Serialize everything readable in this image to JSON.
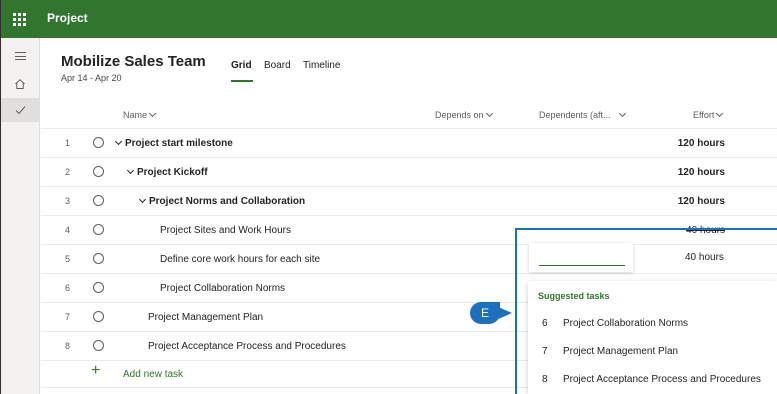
{
  "app": {
    "title": "Project"
  },
  "plan": {
    "title": "Mobilize Sales Team",
    "dates": "Apr 14 - Apr 20"
  },
  "views": [
    {
      "label": "Grid",
      "active": true
    },
    {
      "label": "Board",
      "active": false
    },
    {
      "label": "Timeline",
      "active": false
    }
  ],
  "columns": {
    "name": "Name",
    "depends_on": "Depends on",
    "dependents": "Dependents (aft...",
    "effort": "Effort"
  },
  "rows": [
    {
      "num": "1",
      "name": "Project start milestone",
      "effort": "120 hours"
    },
    {
      "num": "2",
      "name": "Project Kickoff",
      "effort": "120 hours"
    },
    {
      "num": "3",
      "name": "Project Norms and Collaboration",
      "effort": "120 hours"
    },
    {
      "num": "4",
      "name": "Project Sites and Work Hours",
      "effort": "40 hours"
    },
    {
      "num": "5",
      "name": "Define core work hours for each site",
      "effort": "40 hours"
    },
    {
      "num": "6",
      "name": "Project Collaboration Norms",
      "effort": ""
    },
    {
      "num": "7",
      "name": "Project Management Plan",
      "effort": ""
    },
    {
      "num": "8",
      "name": "Project Acceptance Process and Procedures",
      "effort": ""
    }
  ],
  "add_task": {
    "label": "Add new task"
  },
  "callout": {
    "label": "E"
  },
  "suggestions": {
    "header": "Suggested tasks",
    "items": [
      {
        "num": "6",
        "name": "Project Collaboration Norms"
      },
      {
        "num": "7",
        "name": "Project Management Plan"
      },
      {
        "num": "8",
        "name": "Project Acceptance Process and Procedures"
      }
    ]
  },
  "icons": {
    "waffle": "app-launcher-icon",
    "hamburger": "menu-icon",
    "home": "home-icon",
    "check": "checkmark-icon"
  },
  "colors": {
    "brand": "#31752f",
    "callout": "#1f6fbf"
  }
}
